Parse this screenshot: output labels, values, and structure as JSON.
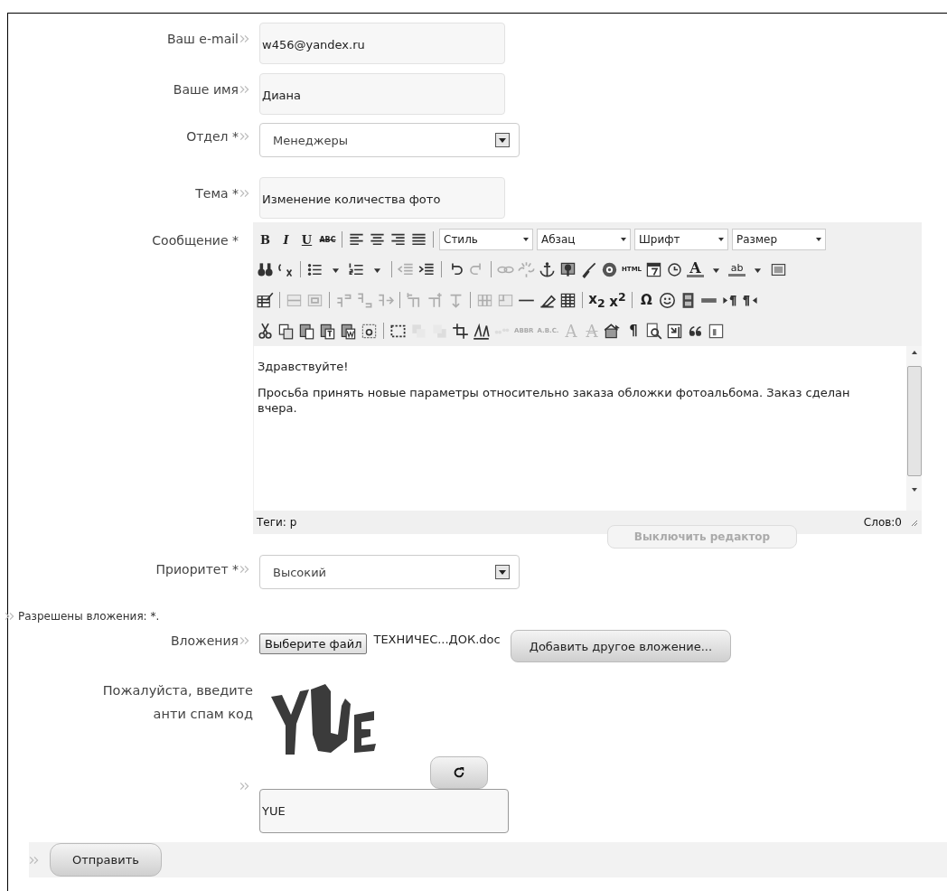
{
  "fields": [
    {
      "kind": "text",
      "label": "Ваш e-mail",
      "value": "w456@yandex.ru"
    },
    {
      "kind": "text",
      "label": "Ваше имя",
      "value": "Диана"
    },
    {
      "kind": "select",
      "label": "Отдел *",
      "value": "Менеджеры"
    },
    {
      "kind": "text",
      "label": "Тема *",
      "value": "Изменение количества фото"
    }
  ],
  "message": {
    "label": "Сообщение *",
    "toolbar": [
      [
        {
          "kind": "bold",
          "text": "B",
          "disabled": false
        },
        {
          "kind": "italic",
          "text": "I",
          "disabled": false
        },
        {
          "kind": "underline",
          "text": "U",
          "disabled": false
        },
        {
          "kind": "strike",
          "text": "ABC",
          "disabled": false
        },
        {
          "kind": "sep"
        },
        {
          "kind": "icon",
          "disabled": false
        },
        {
          "kind": "icon",
          "disabled": false
        },
        {
          "kind": "icon",
          "disabled": false
        },
        {
          "kind": "icon",
          "disabled": false
        },
        {
          "kind": "sep"
        },
        {
          "kind": "select",
          "label": "Стиль",
          "disabled": false
        },
        {
          "kind": "select",
          "label": "Абзац",
          "disabled": false
        },
        {
          "kind": "select",
          "label": "Шрифт",
          "disabled": false
        },
        {
          "kind": "select",
          "label": "Размер",
          "disabled": false
        }
      ],
      [
        {
          "kind": "icon",
          "disabled": false
        },
        {
          "kind": "icon",
          "disabled": false
        },
        {
          "kind": "sep"
        },
        {
          "kind": "icon",
          "disabled": false
        },
        {
          "kind": "icon",
          "disabled": false
        },
        {
          "kind": "icon",
          "disabled": false
        },
        {
          "kind": "icon",
          "disabled": false
        },
        {
          "kind": "sep"
        },
        {
          "kind": "icon",
          "disabled": true
        },
        {
          "kind": "icon",
          "disabled": false
        },
        {
          "kind": "sep"
        },
        {
          "kind": "icon",
          "disabled": false
        },
        {
          "kind": "icon",
          "disabled": true
        },
        {
          "kind": "sep"
        },
        {
          "kind": "icon",
          "disabled": true
        },
        {
          "kind": "icon",
          "disabled": true
        },
        {
          "kind": "icon",
          "disabled": false
        },
        {
          "kind": "icon",
          "disabled": false
        },
        {
          "kind": "icon",
          "disabled": false
        },
        {
          "kind": "icon",
          "disabled": false
        },
        {
          "kind": "small",
          "text": "HTML",
          "disabled": false
        },
        {
          "kind": "icon",
          "disabled": false
        },
        {
          "kind": "icon",
          "disabled": false
        },
        {
          "kind": "color",
          "text": "A",
          "disabled": false
        },
        {
          "kind": "icon",
          "disabled": false
        },
        {
          "kind": "highlight",
          "text": "ab",
          "disabled": false
        },
        {
          "kind": "icon",
          "disabled": false
        },
        {
          "kind": "icon",
          "disabled": false
        }
      ],
      [
        {
          "kind": "icon",
          "disabled": false
        },
        {
          "kind": "sep"
        },
        {
          "kind": "icon",
          "disabled": true
        },
        {
          "kind": "icon",
          "disabled": true
        },
        {
          "kind": "sep"
        },
        {
          "kind": "icon",
          "disabled": true
        },
        {
          "kind": "icon",
          "disabled": true
        },
        {
          "kind": "icon",
          "disabled": true
        },
        {
          "kind": "sep"
        },
        {
          "kind": "icon",
          "disabled": true
        },
        {
          "kind": "icon",
          "disabled": true
        },
        {
          "kind": "icon",
          "disabled": true
        },
        {
          "kind": "sep"
        },
        {
          "kind": "icon",
          "disabled": true
        },
        {
          "kind": "icon",
          "disabled": true
        },
        {
          "kind": "icon",
          "disabled": false
        },
        {
          "kind": "icon",
          "disabled": false
        },
        {
          "kind": "icon",
          "disabled": false
        },
        {
          "kind": "sep"
        },
        {
          "kind": "glyph",
          "text": "x$_{2}$",
          "disabled": false
        },
        {
          "kind": "glyph",
          "text": "x$^{2}$",
          "disabled": false
        },
        {
          "kind": "sep"
        },
        {
          "kind": "glyph",
          "text": "Ω",
          "disabled": false
        },
        {
          "kind": "icon",
          "disabled": false
        },
        {
          "kind": "icon",
          "disabled": false
        },
        {
          "kind": "icon",
          "disabled": false
        },
        {
          "kind": "icon",
          "disabled": false
        },
        {
          "kind": "icon",
          "disabled": false
        }
      ],
      [
        {
          "kind": "icon",
          "disabled": false
        },
        {
          "kind": "icon",
          "disabled": false
        },
        {
          "kind": "icon",
          "disabled": false
        },
        {
          "kind": "icon",
          "disabled": false
        },
        {
          "kind": "icon",
          "disabled": false
        },
        {
          "kind": "icon",
          "disabled": false
        },
        {
          "kind": "sep"
        },
        {
          "kind": "icon",
          "disabled": false
        },
        {
          "kind": "icon",
          "disabled": true
        },
        {
          "kind": "icon",
          "disabled": true
        },
        {
          "kind": "icon",
          "disabled": false
        },
        {
          "kind": "icon",
          "disabled": false
        },
        {
          "kind": "icon",
          "disabled": true
        },
        {
          "kind": "small",
          "text": "ABBR",
          "disabled": true
        },
        {
          "kind": "small",
          "text": "A.B.C.",
          "disabled": true
        },
        {
          "kind": "serif",
          "text": "A",
          "disabled": true
        },
        {
          "kind": "strike-serif",
          "text": "A",
          "disabled": true
        },
        {
          "kind": "icon",
          "disabled": false
        },
        {
          "kind": "glyph",
          "text": "¶",
          "disabled": false
        },
        {
          "kind": "icon",
          "disabled": false
        },
        {
          "kind": "icon",
          "disabled": false
        },
        {
          "kind": "icon",
          "disabled": false
        },
        {
          "kind": "icon",
          "disabled": false
        }
      ]
    ],
    "paragraphs": [
      "Здравствуйте!",
      "Просьба принять новые параметры относительно заказа обложки фотоальбома. Заказ сделан вчера."
    ],
    "path": "Теги: p",
    "word_count": "Слов:0",
    "toggle_button": {
      "label": "Выключить редактор",
      "disabled": true
    }
  },
  "priority": {
    "label": "Приоритет *",
    "value": "Высокий"
  },
  "attachments": {
    "note": "Разрешены вложения: *.",
    "label": "Вложения",
    "choose_button": "Выберите файл",
    "file_name": "ТЕХНИЧЕС...ДОК.doc",
    "add_button": "Добавить другое вложение..."
  },
  "captcha": {
    "label": "Пожалуйста, введите анти спам код",
    "value": "YUE"
  },
  "submit": "Отправить"
}
